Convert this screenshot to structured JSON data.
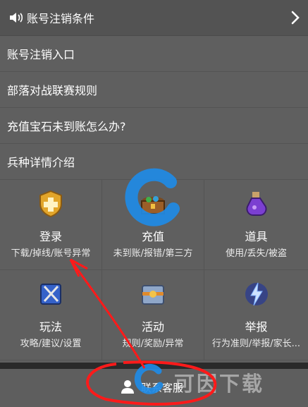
{
  "notice": {
    "icon": "speaker-icon",
    "label": "账号注销条件",
    "chevron": "chevron-right-icon"
  },
  "faq": [
    "账号注销入口",
    "部落对战联赛规则",
    "充值宝石未到账怎么办?",
    "兵种详情介绍"
  ],
  "categories": [
    {
      "icon": "shield-plus-icon",
      "title": "登录",
      "sub": "下载/掉线/账号异常"
    },
    {
      "icon": "treasure-chest-icon",
      "title": "充值",
      "sub": "未到账/报错/第三方"
    },
    {
      "icon": "potion-icon",
      "title": "道具",
      "sub": "使用/丢失/被盗"
    },
    {
      "icon": "spellbook-icon",
      "title": "玩法",
      "sub": "攻略/建议/设置"
    },
    {
      "icon": "event-chest-icon",
      "title": "活动",
      "sub": "规则/奖励/异常"
    },
    {
      "icon": "lightning-report-icon",
      "title": "举报",
      "sub": "行为准则/举报/家长..."
    }
  ],
  "contact": {
    "icon": "person-icon",
    "label": "联系客服"
  },
  "watermark": {
    "icon": "c-logo-icon",
    "text": "可因下载"
  },
  "colors": {
    "background": "#5f5f5f",
    "header": "#535353",
    "annotation": "#ff1a1a",
    "logo_blue": "#1f8be6"
  }
}
